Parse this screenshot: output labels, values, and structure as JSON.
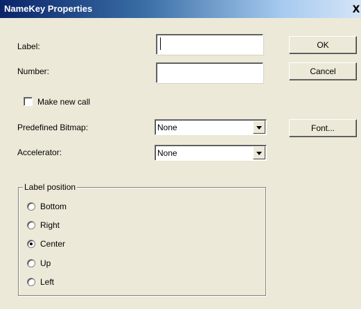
{
  "window": {
    "title": "NameKey Properties",
    "close_glyph": "X"
  },
  "fields": {
    "label_caption": "Label:",
    "label_value": "",
    "number_caption": "Number:",
    "number_value": ""
  },
  "make_new_call": {
    "label": "Make new call",
    "checked": false
  },
  "predefined_bitmap": {
    "caption": "Predefined Bitmap:",
    "selected": "None"
  },
  "accelerator": {
    "caption": "Accelerator:",
    "selected": "None"
  },
  "buttons": {
    "ok": "OK",
    "cancel": "Cancel",
    "font": "Font..."
  },
  "label_position": {
    "title": "Label position",
    "options": [
      {
        "label": "Bottom",
        "checked": false
      },
      {
        "label": "Right",
        "checked": false
      },
      {
        "label": "Center",
        "checked": true
      },
      {
        "label": "Up",
        "checked": false
      },
      {
        "label": "Left",
        "checked": false
      }
    ]
  },
  "colors": {
    "title_bar_start": "#0a246a",
    "title_bar_end": "#d4e4f7",
    "dialog_bg": "#ece9d8"
  }
}
